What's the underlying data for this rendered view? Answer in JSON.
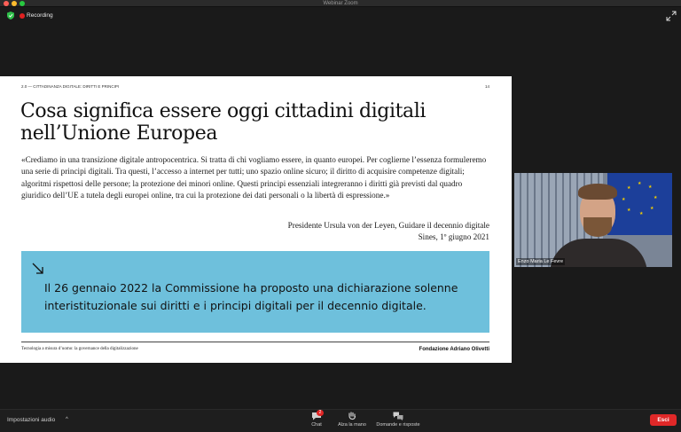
{
  "window": {
    "title": "Webinar Zoom"
  },
  "meeting": {
    "recording_label": "Recording"
  },
  "slide": {
    "header_left": "2.0 — CITTADINANZA DIGITALE: DIRITTI E PRINCIPI",
    "page_number": "14",
    "title_line1": "Cosa significa essere oggi cittadini digitali",
    "title_line2": "nell’Unione Europea",
    "quote": "«Crediamo in una transizione digitale antropocentrica. Si tratta di chi vogliamo essere, in quanto europei. Per coglierne l’essenza formuleremo una serie di principi digitali. Tra questi, l’accesso a internet per tutti; uno spazio online sicuro; il diritto di acquisire competenze digitali; algoritmi rispettosi delle persone; la protezione dei minori online. Questi principi essenziali integreranno i diritti già previsti dal quadro giuridico dell’UE a tutela degli europei online, tra cui la protezione dei dati personali o la libertà di espressione.»",
    "attribution_line1": "Presidente Ursula von der Leyen, Guidare il decennio digitale",
    "attribution_line2": "Sines, 1º giugno 2021",
    "callout_text": "Il 26 gennaio 2022 la Commissione ha proposto una dichiarazione solenne interistituzionale sui diritti e i principi digitali per il decennio digitale.",
    "footer_left": "Tecnologia a misura d’uomo: la governance della digitalizzazione",
    "footer_right": "Fondazione Adriano Olivetti"
  },
  "participant": {
    "name": "Enzo Maria Le Fevre"
  },
  "toolbar": {
    "audio_settings": "Impostazioni audio",
    "chat_label": "Chat",
    "chat_badge": "2",
    "raise_hand_label": "Alza la mano",
    "qa_label": "Domande e risposte",
    "exit_label": "Esci"
  },
  "colors": {
    "callout": "#6ec0dc",
    "exit": "#e02828",
    "recording": "#e02020",
    "shield": "#2fbf4a"
  }
}
